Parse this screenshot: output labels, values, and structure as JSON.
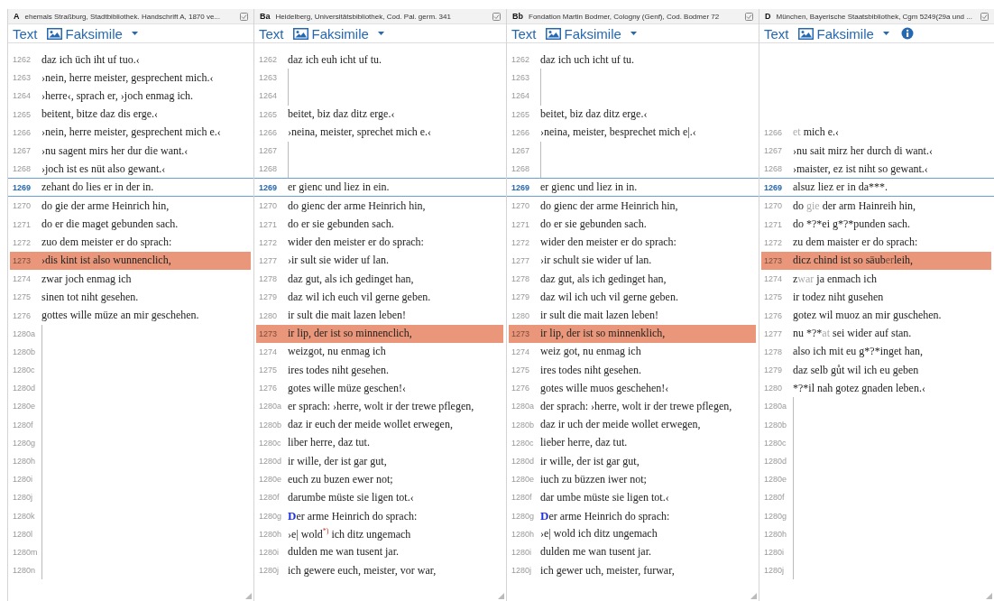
{
  "panels": [
    {
      "siglum": "A",
      "title": "ehemals Straßburg, Stadtbibliothek. Handschrift A, 1870 ve...",
      "tabs": {
        "text": "Text",
        "facsimile": "Faksimile"
      },
      "info_button": false,
      "rows": [
        {
          "number": "1262",
          "kind": "verse",
          "current": false,
          "highlighted": false,
          "text": "daz ich üch iht uf tuo.‹"
        },
        {
          "number": "1263",
          "kind": "verse",
          "current": false,
          "highlighted": false,
          "text": "›nein, herre meister, gesprechent mich.‹"
        },
        {
          "number": "1264",
          "kind": "verse",
          "current": false,
          "highlighted": false,
          "text": "›herre‹, sprach er, ›joch enmag ich."
        },
        {
          "number": "1265",
          "kind": "verse",
          "current": false,
          "highlighted": false,
          "text": "beitent, bitze daz dis erge.‹"
        },
        {
          "number": "1266",
          "kind": "verse",
          "current": false,
          "highlighted": false,
          "text": "›nein, herre meister, gesprechent mich e.‹"
        },
        {
          "number": "1267",
          "kind": "verse",
          "current": false,
          "highlighted": false,
          "text": "›nu sagent mirs her dur die want.‹"
        },
        {
          "number": "1268",
          "kind": "verse",
          "current": false,
          "highlighted": false,
          "text": "›joch ist es nüt also gewant.‹"
        },
        {
          "number": "1269",
          "kind": "verse",
          "current": true,
          "highlighted": false,
          "text": "zehant do lies er in der in."
        },
        {
          "number": "1270",
          "kind": "verse",
          "current": false,
          "highlighted": false,
          "text": "do gie der arme Heinrich hin,"
        },
        {
          "number": "1271",
          "kind": "verse",
          "current": false,
          "highlighted": false,
          "text": "do er die maget gebunden sach."
        },
        {
          "number": "1272",
          "kind": "verse",
          "current": false,
          "highlighted": false,
          "text": "zuo dem meister er do sprach:"
        },
        {
          "number": "1273",
          "kind": "verse",
          "current": false,
          "highlighted": true,
          "text": "›dis kint ist also wunnenclich,"
        },
        {
          "number": "1274",
          "kind": "verse",
          "current": false,
          "highlighted": false,
          "text": "zwar joch enmag ich"
        },
        {
          "number": "1275",
          "kind": "verse",
          "current": false,
          "highlighted": false,
          "text": "sinen tot niht gesehen."
        },
        {
          "number": "1276",
          "kind": "verse",
          "current": false,
          "highlighted": false,
          "text": "gottes wille müze an mir geschehen."
        },
        {
          "number": "1280a",
          "kind": "gap",
          "current": false,
          "highlighted": false
        },
        {
          "number": "1280b",
          "kind": "gap",
          "current": false,
          "highlighted": false
        },
        {
          "number": "1280c",
          "kind": "gap",
          "current": false,
          "highlighted": false
        },
        {
          "number": "1280d",
          "kind": "gap",
          "current": false,
          "highlighted": false
        },
        {
          "number": "1280e",
          "kind": "gap",
          "current": false,
          "highlighted": false
        },
        {
          "number": "1280f",
          "kind": "gap",
          "current": false,
          "highlighted": false
        },
        {
          "number": "1280g",
          "kind": "gap",
          "current": false,
          "highlighted": false
        },
        {
          "number": "1280h",
          "kind": "gap",
          "current": false,
          "highlighted": false
        },
        {
          "number": "1280i",
          "kind": "gap",
          "current": false,
          "highlighted": false
        },
        {
          "number": "1280j",
          "kind": "gap",
          "current": false,
          "highlighted": false
        },
        {
          "number": "1280k",
          "kind": "gap",
          "current": false,
          "highlighted": false
        },
        {
          "number": "1280l",
          "kind": "gap",
          "current": false,
          "highlighted": false
        },
        {
          "number": "1280m",
          "kind": "gap",
          "current": false,
          "highlighted": false
        },
        {
          "number": "1280n",
          "kind": "gap",
          "current": false,
          "highlighted": false
        }
      ]
    },
    {
      "siglum": "Ba",
      "title": "Heidelberg, Universitätsbibliothek, Cod. Pal. germ. 341",
      "tabs": {
        "text": "Text",
        "facsimile": "Faksimile"
      },
      "info_button": false,
      "rows": [
        {
          "number": "1262",
          "kind": "verse",
          "current": false,
          "highlighted": false,
          "text": "daz ich euh icht uf tu."
        },
        {
          "number": "1263",
          "kind": "gap",
          "current": false,
          "highlighted": false
        },
        {
          "number": "1264",
          "kind": "gap",
          "current": false,
          "highlighted": false
        },
        {
          "number": "1265",
          "kind": "verse",
          "current": false,
          "highlighted": false,
          "text": "beitet, biz daz ditz erge.‹"
        },
        {
          "number": "1266",
          "kind": "verse",
          "current": false,
          "highlighted": false,
          "text": "›neina, meister, sprechet mich e.‹"
        },
        {
          "number": "1267",
          "kind": "gap",
          "current": false,
          "highlighted": false
        },
        {
          "number": "1268",
          "kind": "gap",
          "current": false,
          "highlighted": false
        },
        {
          "number": "1269",
          "kind": "verse",
          "current": true,
          "highlighted": false,
          "text": "er gienc und liez in ein."
        },
        {
          "number": "1270",
          "kind": "verse",
          "current": false,
          "highlighted": false,
          "text": "do gienc der arme Heinrich hin,"
        },
        {
          "number": "1271",
          "kind": "verse",
          "current": false,
          "highlighted": false,
          "text": "do er sie gebunden sach."
        },
        {
          "number": "1272",
          "kind": "verse",
          "current": false,
          "highlighted": false,
          "text": "wider den meister er do sprach:"
        },
        {
          "number": "1277",
          "kind": "verse",
          "current": false,
          "highlighted": false,
          "text": "›ir sult sie wider uf lan."
        },
        {
          "number": "1278",
          "kind": "verse",
          "current": false,
          "highlighted": false,
          "text": "daz gut, als ich gedinget han,"
        },
        {
          "number": "1279",
          "kind": "verse",
          "current": false,
          "highlighted": false,
          "text": "daz wil ich euch vil gerne geben."
        },
        {
          "number": "1280",
          "kind": "verse",
          "current": false,
          "highlighted": false,
          "text": "ir sult die mait lazen leben!"
        },
        {
          "number": "1273",
          "kind": "verse",
          "current": false,
          "highlighted": true,
          "text": "ir lip, der ist so minnenclich,"
        },
        {
          "number": "1274",
          "kind": "verse",
          "current": false,
          "highlighted": false,
          "text": "weizgot, nu enmag ich"
        },
        {
          "number": "1275",
          "kind": "verse",
          "current": false,
          "highlighted": false,
          "text": "ires todes niht gesehen."
        },
        {
          "number": "1276",
          "kind": "verse",
          "current": false,
          "highlighted": false,
          "text": "gotes wille müze geschen!‹"
        },
        {
          "number": "1280a",
          "kind": "verse",
          "current": false,
          "highlighted": false,
          "text": "er sprach: ›herre, wolt ir der trewe pflegen,"
        },
        {
          "number": "1280b",
          "kind": "verse",
          "current": false,
          "highlighted": false,
          "text": "daz ir euch der meide wollet erwegen,"
        },
        {
          "number": "1280c",
          "kind": "verse",
          "current": false,
          "highlighted": false,
          "text": "liber herre, daz tut."
        },
        {
          "number": "1280d",
          "kind": "verse",
          "current": false,
          "highlighted": false,
          "text": "ir wille, der ist gar gut,"
        },
        {
          "number": "1280e",
          "kind": "verse",
          "current": false,
          "highlighted": false,
          "text": "euch zu buzen ewer not;"
        },
        {
          "number": "1280f",
          "kind": "verse",
          "current": false,
          "highlighted": false,
          "text": "darumbe müste sie ligen tot.‹"
        },
        {
          "number": "1280g",
          "kind": "verse",
          "current": false,
          "highlighted": false,
          "segments": [
            {
              "text": "D",
              "kind": "initial"
            },
            {
              "text": "er arme Heinrich do sprach:",
              "kind": "plain"
            }
          ]
        },
        {
          "number": "1280h",
          "kind": "verse",
          "current": false,
          "highlighted": false,
          "segments": [
            {
              "text": "›e| wold",
              "kind": "plain"
            },
            {
              "text": "*)",
              "kind": "note"
            },
            {
              "text": " ich ditz ungemach",
              "kind": "plain"
            }
          ]
        },
        {
          "number": "1280i",
          "kind": "verse",
          "current": false,
          "highlighted": false,
          "text": "dulden me wan tusent jar."
        },
        {
          "number": "1280j",
          "kind": "verse",
          "current": false,
          "highlighted": false,
          "text": "ich gewere euch, meister, vor war,"
        }
      ]
    },
    {
      "siglum": "Bb",
      "title": "Fondation Martin Bodmer, Cologny (Genf), Cod. Bodmer 72",
      "tabs": {
        "text": "Text",
        "facsimile": "Faksimile"
      },
      "info_button": false,
      "rows": [
        {
          "number": "1262",
          "kind": "verse",
          "current": false,
          "highlighted": false,
          "text": "daz ich uch icht uf tu."
        },
        {
          "number": "1263",
          "kind": "gap",
          "current": false,
          "highlighted": false
        },
        {
          "number": "1264",
          "kind": "gap",
          "current": false,
          "highlighted": false
        },
        {
          "number": "1265",
          "kind": "verse",
          "current": false,
          "highlighted": false,
          "text": "beitet, biz daz ditz erge.‹"
        },
        {
          "number": "1266",
          "kind": "verse",
          "current": false,
          "highlighted": false,
          "text": "›neina, meister, besprechet mich e|.‹"
        },
        {
          "number": "1267",
          "kind": "gap",
          "current": false,
          "highlighted": false
        },
        {
          "number": "1268",
          "kind": "gap",
          "current": false,
          "highlighted": false
        },
        {
          "number": "1269",
          "kind": "verse",
          "current": true,
          "highlighted": false,
          "text": "er gienc und liez in in."
        },
        {
          "number": "1270",
          "kind": "verse",
          "current": false,
          "highlighted": false,
          "text": "do gienc der arme Heinrich hin,"
        },
        {
          "number": "1271",
          "kind": "verse",
          "current": false,
          "highlighted": false,
          "text": "do er sie gebunden sach."
        },
        {
          "number": "1272",
          "kind": "verse",
          "current": false,
          "highlighted": false,
          "text": "wider den meister er do sprach:"
        },
        {
          "number": "1277",
          "kind": "verse",
          "current": false,
          "highlighted": false,
          "text": "›ir schult sie wider uf lan."
        },
        {
          "number": "1278",
          "kind": "verse",
          "current": false,
          "highlighted": false,
          "text": "daz gut, als ich gedinget han,"
        },
        {
          "number": "1279",
          "kind": "verse",
          "current": false,
          "highlighted": false,
          "text": "daz wil ich uch vil gerne geben."
        },
        {
          "number": "1280",
          "kind": "verse",
          "current": false,
          "highlighted": false,
          "text": "ir sult die mait lazen leben!"
        },
        {
          "number": "1273",
          "kind": "verse",
          "current": false,
          "highlighted": true,
          "text": "ir lip, der ist so minnenklich,"
        },
        {
          "number": "1274",
          "kind": "verse",
          "current": false,
          "highlighted": false,
          "text": "weiz got, nu enmag ich"
        },
        {
          "number": "1275",
          "kind": "verse",
          "current": false,
          "highlighted": false,
          "text": "ires todes niht gesehen."
        },
        {
          "number": "1276",
          "kind": "verse",
          "current": false,
          "highlighted": false,
          "text": "gotes wille muos geschehen!‹"
        },
        {
          "number": "1280a",
          "kind": "verse",
          "current": false,
          "highlighted": false,
          "text": "der sprach: ›herre, wolt ir der trewe pflegen,"
        },
        {
          "number": "1280b",
          "kind": "verse",
          "current": false,
          "highlighted": false,
          "text": "daz ir uch der meide wollet erwegen,"
        },
        {
          "number": "1280c",
          "kind": "verse",
          "current": false,
          "highlighted": false,
          "text": "lieber herre, daz tut."
        },
        {
          "number": "1280d",
          "kind": "verse",
          "current": false,
          "highlighted": false,
          "text": "ir wille, der ist gar gut,"
        },
        {
          "number": "1280e",
          "kind": "verse",
          "current": false,
          "highlighted": false,
          "text": "iuch zu büzzen iwer not;"
        },
        {
          "number": "1280f",
          "kind": "verse",
          "current": false,
          "highlighted": false,
          "text": "dar umbe müste sie ligen tot.‹"
        },
        {
          "number": "1280g",
          "kind": "verse",
          "current": false,
          "highlighted": false,
          "segments": [
            {
              "text": "D",
              "kind": "initial"
            },
            {
              "text": "er arme Heinrich do sprach:",
              "kind": "plain"
            }
          ]
        },
        {
          "number": "1280h",
          "kind": "verse",
          "current": false,
          "highlighted": false,
          "text": "›e| wold ich ditz ungemach"
        },
        {
          "number": "1280i",
          "kind": "verse",
          "current": false,
          "highlighted": false,
          "text": "dulden me wan tusent jar."
        },
        {
          "number": "1280j",
          "kind": "verse",
          "current": false,
          "highlighted": false,
          "text": "ich gewer uch, meister, furwar,"
        }
      ]
    },
    {
      "siglum": "D",
      "title": "München, Bayerische Staatsbibliothek, Cgm 5249(29a und ...",
      "tabs": {
        "text": "Text",
        "facsimile": "Faksimile"
      },
      "info_button": true,
      "rows": [
        {
          "kind": "blank",
          "current": false,
          "highlighted": false
        },
        {
          "kind": "blank",
          "current": false,
          "highlighted": false
        },
        {
          "kind": "blank",
          "current": false,
          "highlighted": false
        },
        {
          "kind": "blank",
          "current": false,
          "highlighted": false
        },
        {
          "number": "1266",
          "kind": "verse",
          "current": false,
          "highlighted": false,
          "segments": [
            {
              "text": "et",
              "kind": "faded"
            },
            {
              "text": " mich e.‹",
              "kind": "plain"
            }
          ]
        },
        {
          "number": "1267",
          "kind": "verse",
          "current": false,
          "highlighted": false,
          "text": "›nu sait mirz her durch di want.‹"
        },
        {
          "number": "1268",
          "kind": "verse",
          "current": false,
          "highlighted": false,
          "text": "›maister, ez ist niht so gewant.‹"
        },
        {
          "number": "1269",
          "kind": "verse",
          "current": true,
          "highlighted": false,
          "text": "alsuz liez er in da***."
        },
        {
          "number": "1270",
          "kind": "verse",
          "current": false,
          "highlighted": false,
          "segments": [
            {
              "text": "do ",
              "kind": "plain"
            },
            {
              "text": "gie",
              "kind": "faded"
            },
            {
              "text": " der arm Hainreih hin,",
              "kind": "plain"
            }
          ]
        },
        {
          "number": "1271",
          "kind": "verse",
          "current": false,
          "highlighted": false,
          "text": "do *?*ei g*?*punden sach."
        },
        {
          "number": "1272",
          "kind": "verse",
          "current": false,
          "highlighted": false,
          "text": "zu dem maister er do sprach:"
        },
        {
          "number": "1273",
          "kind": "verse",
          "current": false,
          "highlighted": true,
          "segments": [
            {
              "text": "dicz chind ist so säub",
              "kind": "plain"
            },
            {
              "text": "er",
              "kind": "faded"
            },
            {
              "text": "leih,",
              "kind": "plain"
            }
          ]
        },
        {
          "number": "1274",
          "kind": "verse",
          "current": false,
          "highlighted": false,
          "segments": [
            {
              "text": "z",
              "kind": "plain"
            },
            {
              "text": "war",
              "kind": "faded"
            },
            {
              "text": " ja enmach ich",
              "kind": "plain"
            }
          ]
        },
        {
          "number": "1275",
          "kind": "verse",
          "current": false,
          "highlighted": false,
          "text": "ir todez niht gusehen"
        },
        {
          "number": "1276",
          "kind": "verse",
          "current": false,
          "highlighted": false,
          "text": "gotez wil muoz an mir guschehen."
        },
        {
          "number": "1277",
          "kind": "verse",
          "current": false,
          "highlighted": false,
          "segments": [
            {
              "text": "nu *?*",
              "kind": "plain"
            },
            {
              "text": "at",
              "kind": "faded"
            },
            {
              "text": " sei wider auf stan.",
              "kind": "plain"
            }
          ]
        },
        {
          "number": "1278",
          "kind": "verse",
          "current": false,
          "highlighted": false,
          "text": "also ich mit eu g*?*inget han,"
        },
        {
          "number": "1279",
          "kind": "verse",
          "current": false,
          "highlighted": false,
          "text": "daz selb gůt wil ich eu geben"
        },
        {
          "number": "1280",
          "kind": "verse",
          "current": false,
          "highlighted": false,
          "text": "*?*il nah gotez gnaden leben.‹"
        },
        {
          "number": "1280a",
          "kind": "gap",
          "current": false,
          "highlighted": false
        },
        {
          "number": "1280b",
          "kind": "gap",
          "current": false,
          "highlighted": false
        },
        {
          "number": "1280c",
          "kind": "gap",
          "current": false,
          "highlighted": false
        },
        {
          "number": "1280d",
          "kind": "gap",
          "current": false,
          "highlighted": false
        },
        {
          "number": "1280e",
          "kind": "gap",
          "current": false,
          "highlighted": false
        },
        {
          "number": "1280f",
          "kind": "gap",
          "current": false,
          "highlighted": false
        },
        {
          "number": "1280g",
          "kind": "gap",
          "current": false,
          "highlighted": false
        },
        {
          "number": "1280h",
          "kind": "gap",
          "current": false,
          "highlighted": false
        },
        {
          "number": "1280i",
          "kind": "gap",
          "current": false,
          "highlighted": false
        },
        {
          "number": "1280j",
          "kind": "gap",
          "current": false,
          "highlighted": false
        }
      ]
    }
  ]
}
